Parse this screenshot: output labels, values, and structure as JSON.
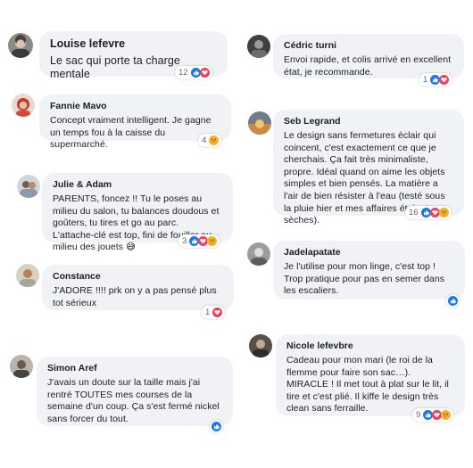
{
  "comments": [
    {
      "name": "Louise lefevre",
      "text": "Le sac qui porte ta charge mentale",
      "count": "12",
      "reactions": [
        "like-icon",
        "love-icon"
      ]
    },
    {
      "name": "Cédric turni",
      "text": "Envoi rapide, et colis arrivé en excellent état, je recommande.",
      "count": "1",
      "reactions": [
        "like-icon",
        "love-icon"
      ]
    },
    {
      "name": "Fannie Mavo",
      "text": "Concept vraiment intelligent. Je gagne un temps fou à la caisse du supermarché.",
      "count": "4",
      "reactions": [
        "haha-icon"
      ]
    },
    {
      "name": "Seb Legrand",
      "text": "Le design sans fermetures éclair qui coincent, c'est exactement ce que je cherchais. Ça fait très minimaliste, propre. Idéal quand on aime les objets simples et bien pensés. La matière a l'air de bien résister à l'eau (testé sous la pluie hier et mes affaires étaient sèches).",
      "count": "16",
      "reactions": [
        "like-icon",
        "love-icon",
        "haha-icon"
      ]
    },
    {
      "name": "Julie & Adam",
      "text": "PARENTS, foncez !! Tu le poses au milieu du salon, tu balances doudous et goûters, tu tires et go au parc. L'attache-clé est top, fini de fouiller au milieu des jouets 😅",
      "count": "3",
      "reactions": [
        "like-icon",
        "love-icon",
        "haha-icon"
      ]
    },
    {
      "name": "Jadelapatate",
      "text": "Je l'utilise pour mon linge, c'est top ! Trop pratique pour pas en semer dans les escaliers.",
      "count": "",
      "reactions": [
        "like-icon"
      ]
    },
    {
      "name": "Constance",
      "text": "J'ADORE !!!! prk on y a pas pensé plus tot sérieux",
      "count": "1",
      "reactions": [
        "love-icon"
      ]
    },
    {
      "name": "Nicole lefevbre",
      "text": "Cadeau pour mon mari (le roi de la flemme pour faire son sac…). MIRACLE ! Il met tout à plat sur le lit, il tire et c'est plié. Il kiffe le design très clean sans ferraille.",
      "count": "9",
      "reactions": [
        "like-icon",
        "love-icon",
        "haha-icon"
      ]
    },
    {
      "name": "Simon Aref",
      "text": "J'avais un doute sur la taille mais j'ai rentré TOUTES mes courses de la semaine d'un coup. Ça s'est fermé nickel sans forcer du tout.",
      "count": "",
      "reactions": [
        "like-icon"
      ]
    }
  ],
  "colors": {
    "bubble": "#f0f2f5",
    "like": "#1877f2",
    "love": "#f33e58",
    "haha": "#f7b125"
  }
}
